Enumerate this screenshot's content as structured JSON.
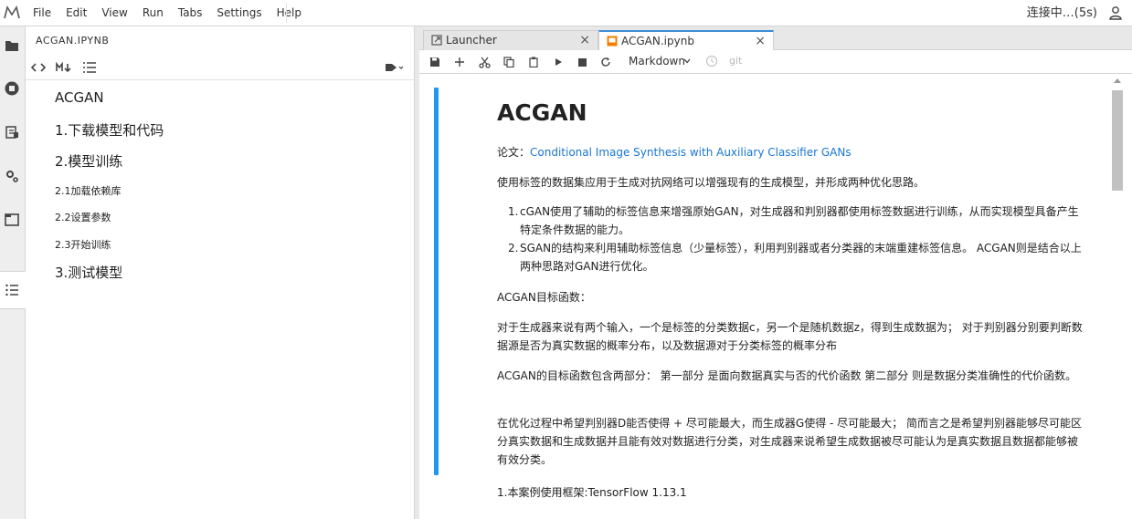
{
  "menubar": {
    "items": [
      "File",
      "Edit",
      "View",
      "Run",
      "Tabs",
      "Settings",
      "Help"
    ],
    "status": "连接中…(5s)"
  },
  "toc": {
    "title": "ACGAN.IPYNB",
    "entries": [
      {
        "text": "ACGAN",
        "level": 1
      },
      {
        "text": "1.下载模型和代码",
        "level": 1
      },
      {
        "text": "2.模型训练",
        "level": 1
      },
      {
        "text": "2.1加载依赖库",
        "level": 3
      },
      {
        "text": "2.2设置参数",
        "level": 3
      },
      {
        "text": "2.3开始训练",
        "level": 3
      },
      {
        "text": "3.测试模型",
        "level": 1
      }
    ]
  },
  "tabs": [
    {
      "label": "Launcher",
      "icon": "launcher-icon"
    },
    {
      "label": "ACGAN.ipynb",
      "icon": "notebook-icon",
      "active": true
    }
  ],
  "notebook_toolbar": {
    "cell_type": "Markdown",
    "git": "git"
  },
  "notebook": {
    "heading": "ACGAN",
    "paper_prefix": "论文：",
    "paper_link": "Conditional Image Synthesis with Auxiliary Classifier GANs",
    "intro": "使用标签的数据集应用于生成对抗网络可以增强现有的生成模型，并形成两种优化思路。",
    "list": [
      "cGAN使用了辅助的标签信息来增强原始GAN，对生成器和判别器都使用标签数据进行训练，从而实现模型具备产生特定条件数据的能力。",
      "SGAN的结构来利用辅助标签信息（少量标签），利用判别器或者分类器的末端重建标签信息。 ACGAN则是结合以上两种思路对GAN进行优化。"
    ],
    "objective_title": "ACGAN目标函数：",
    "p_inputs": "对于生成器来说有两个输入，一个是标签的分类数据c，另一个是随机数据z，得到生成数据为； 对于判别器分别要判断数据源是否为真实数据的概率分布，以及数据源对于分类标签的概率分布",
    "p_parts": "ACGAN的目标函数包含两部分： 第一部分 是面向数据真实与否的代价函数 第二部分 则是数据分类准确性的代价函数。",
    "p_optimize": "在优化过程中希望判别器D能否使得 + 尽可能最大，而生成器G使得 - 尽可能最大； 简而言之是希望判别器能够尽可能区分真实数据和生成数据并且能有效对数据进行分类，对生成器来说希望生成数据被尽可能认为是真实数据且数据都能够被有效分类。",
    "p_framework": "1.本案例使用框架:TensorFlow 1.13.1"
  },
  "colors": {
    "accent": "#2196f3",
    "link": "#1976d2",
    "tab_active_border": "#3d8bd4",
    "activity_bg": "#eeeeee"
  }
}
